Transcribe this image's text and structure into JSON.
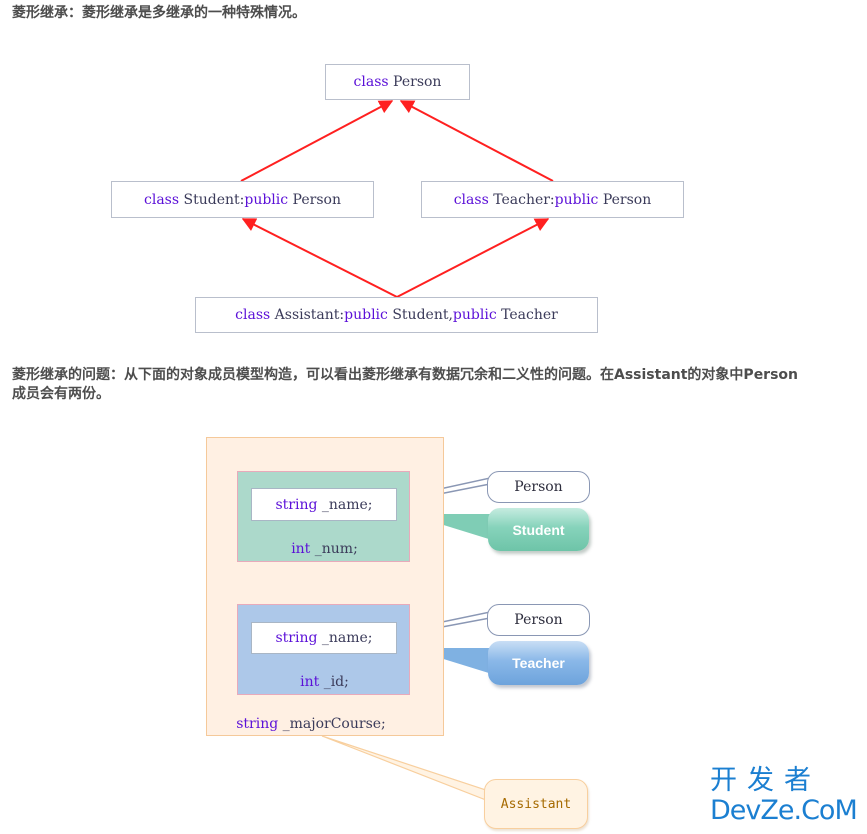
{
  "intro": {
    "text": "菱形继承：菱形继承是多继承的一种特殊情况。"
  },
  "hierarchy": {
    "person": {
      "kw": "class",
      "name": " Person"
    },
    "student": {
      "kw": "class",
      "name": " Student:",
      "kw2": "public",
      "base": " Person"
    },
    "teacher": {
      "kw": "class",
      "name": " Teacher:",
      "kw2": "public",
      "base": " Person"
    },
    "assistant": {
      "kw": "class",
      "name": " Assistant:",
      "kw2": "public",
      "mid": " Student,",
      "kw3": "public",
      "base": " Teacher"
    },
    "arrow_color": "#ff2020",
    "edges": [
      {
        "from": "student",
        "to": "person"
      },
      {
        "from": "teacher",
        "to": "person"
      },
      {
        "from": "assistant",
        "to": "student"
      },
      {
        "from": "assistant",
        "to": "teacher"
      }
    ]
  },
  "problem": {
    "text": "菱形继承的问题：从下面的对象成员模型构造，可以看出菱形继承有数据冗余和二义性的问题。在Assistant的对象中Person成员会有两份。"
  },
  "object_model": {
    "student_part": {
      "color": "#acd9cb",
      "name_field": {
        "type": "string",
        "name": " _name;"
      },
      "own_field": {
        "type": "int",
        "name": " _num;"
      }
    },
    "teacher_part": {
      "color": "#adc8e9",
      "name_field": {
        "type": "string",
        "name": " _name;"
      },
      "own_field": {
        "type": "int",
        "name": " _id;"
      }
    },
    "assistant_field": {
      "type": "string",
      "name": " _majorCourse;"
    },
    "callouts": {
      "person_1": "Person",
      "student": "Student",
      "person_2": "Person",
      "teacher": "Teacher",
      "assistant": "Assistant"
    }
  },
  "watermark": {
    "cn": "开发者",
    "en": "DevZe.CoM"
  }
}
